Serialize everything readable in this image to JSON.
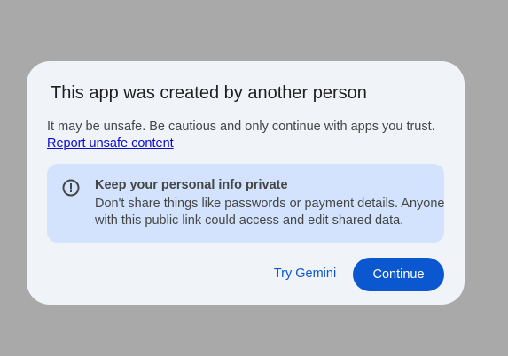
{
  "dialog": {
    "title": "This app was created by another person",
    "body": "It may be unsafe. Be cautious and only continue with apps you trust.",
    "report_link": "Report unsafe content",
    "info": {
      "icon": "exclamation-circle-icon",
      "heading": "Keep your personal info private",
      "text_line1": "Don't share things like passwords or payment details. Anyone",
      "text_line2": "with this public link could access and edit shared data."
    },
    "buttons": {
      "secondary_label": "Try Gemini",
      "primary_label": "Continue"
    }
  },
  "colors": {
    "backdrop": "#a9a9a9",
    "dialog_bg": "#f0f4f9",
    "info_bg": "#d3e3fd",
    "primary": "#0b57d0",
    "link": "#0b0bd6"
  }
}
